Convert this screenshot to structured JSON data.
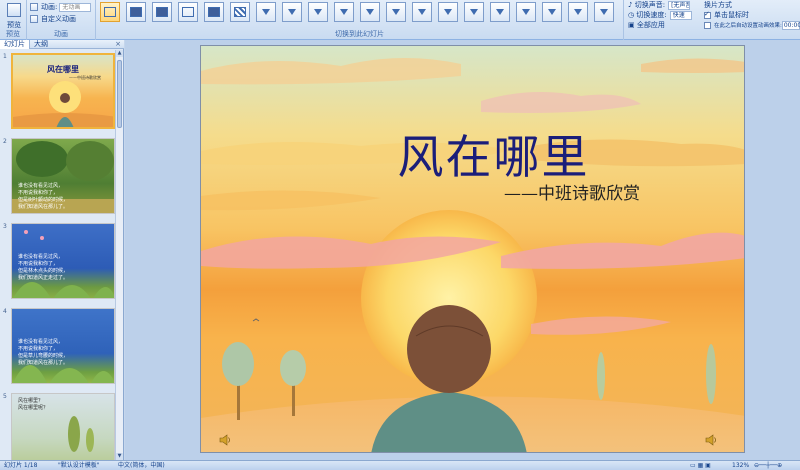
{
  "ribbon": {
    "preview_label": "预览",
    "animation_label": "动画",
    "animate_label": "动画:",
    "animate_value": "无动画",
    "custom_animation_label": "自定义动画",
    "preview_group": "预览",
    "animation_group": "动画",
    "transition_group": "切换到此幻灯片",
    "transition_sound_label": "切换声音:",
    "transition_sound_value": "[无声音]",
    "transition_speed_label": "切换速度:",
    "transition_speed_value": "快速",
    "apply_all_label": "全部应用",
    "advance_label": "换片方式",
    "on_click_label": "单击鼠标时",
    "auto_after_label": "在此之后自动设置动画效果:",
    "auto_after_value": "00:00"
  },
  "panel": {
    "tab_slides": "幻灯片",
    "tab_outline": "大纲",
    "close": "×"
  },
  "thumbnails": [
    {
      "num": "1",
      "title": "风在哪里",
      "subtitle": "——中班诗歌欣赏",
      "lines": ""
    },
    {
      "num": "2",
      "title": "",
      "subtitle": "",
      "lines": "谁也没有看见过风，\n不用说我和你了，\n但是树叶颤动的时候，\n我们知道风在那儿了。"
    },
    {
      "num": "3",
      "title": "",
      "subtitle": "",
      "lines": "谁也没有看见过风，\n不用说我和你了，\n但是林木点头的时候，\n我们知道风正走过了。"
    },
    {
      "num": "4",
      "title": "",
      "subtitle": "",
      "lines": "谁也没有看见过风，\n不用说我和你了，\n但是草儿弯腰的时候，\n我们知道风在那儿了。"
    },
    {
      "num": "5",
      "title": "",
      "subtitle": "",
      "lines": "风在哪里？\n风在哪里呢？"
    }
  ],
  "slide": {
    "title": "风在哪里",
    "subtitle": "——中班诗歌欣赏"
  },
  "status": {
    "slide_info": "幻灯片 1/18",
    "theme": "\"默认设计模板\"",
    "language": "中文(简体，中国)",
    "zoom": "132%"
  },
  "colors": {
    "title": "#1b1e7a",
    "ribbon": "#dce8f6",
    "selection": "#f0b43c"
  }
}
